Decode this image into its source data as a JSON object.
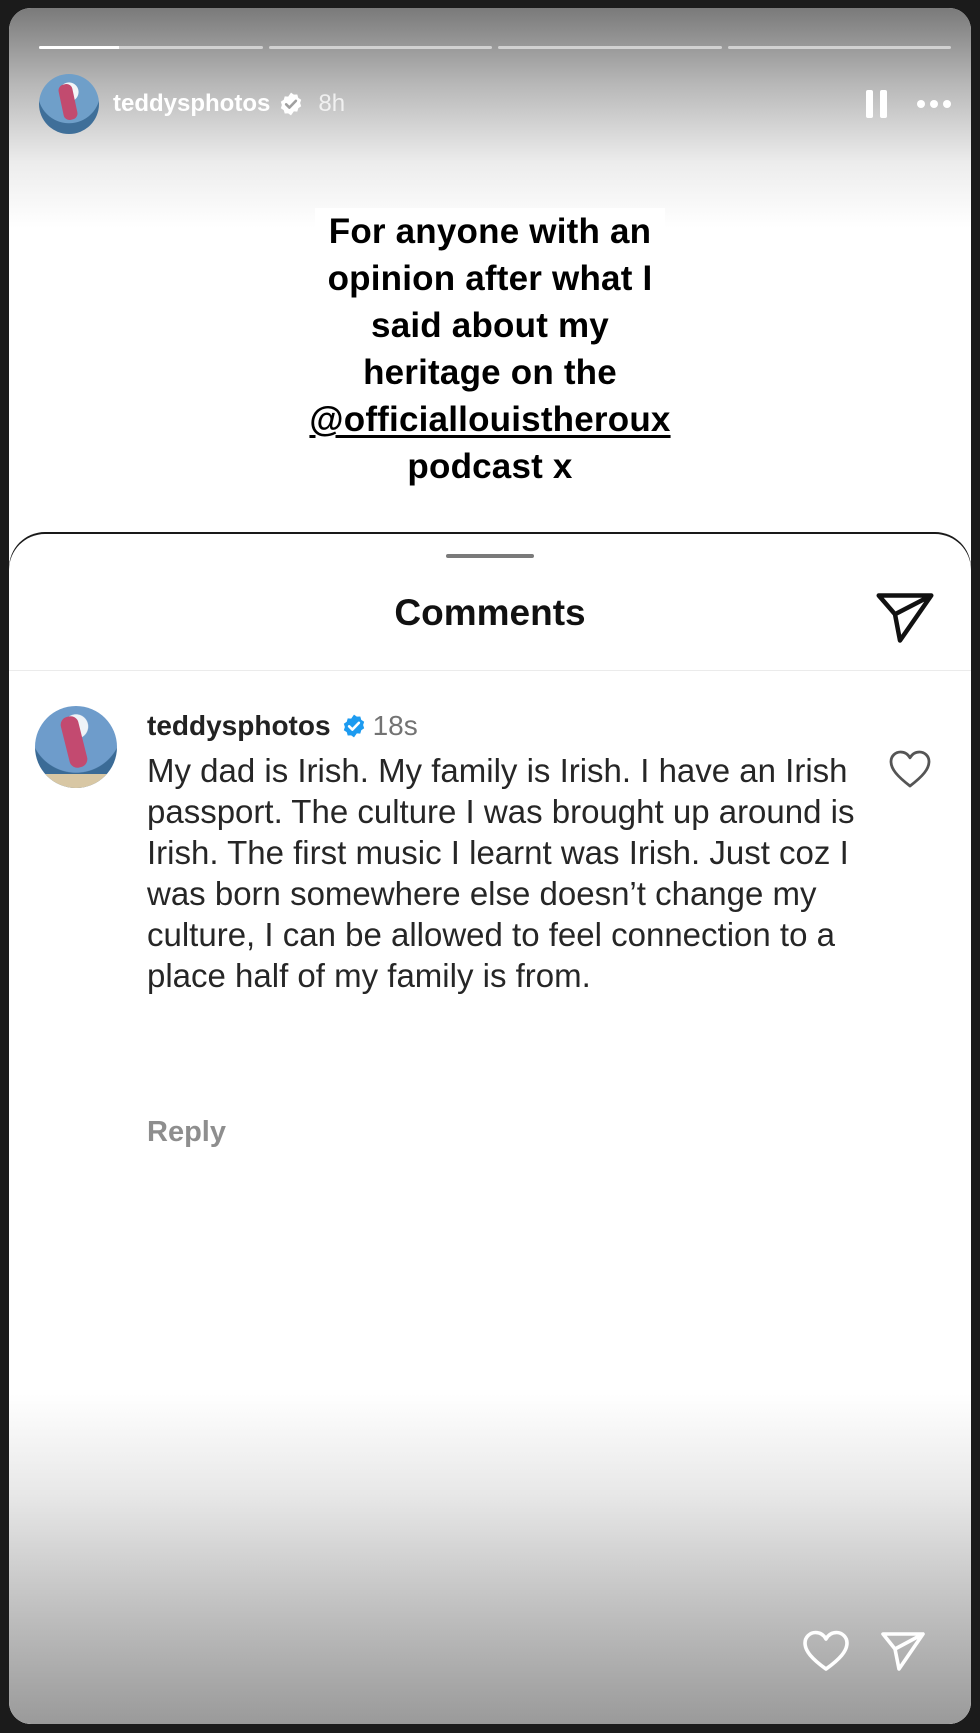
{
  "story": {
    "progress": [
      0.36,
      0,
      0,
      0
    ],
    "username": "teddysphotos",
    "time": "8h",
    "caption_lines": [
      "For anyone with an",
      "opinion after what I",
      "said about my",
      "heritage on the",
      "@officiallouistheroux",
      "podcast x"
    ]
  },
  "comments_sheet": {
    "title": "Comments",
    "comment": {
      "username": "teddysphotos",
      "time": "18s",
      "text": "My dad is Irish. My family is Irish. I have an Irish passport. The culture I was brought up around is Irish. The first music I learnt was Irish. Just coz I was born somewhere else doesn’t change my culture, I can be allowed to feel connection to a place half of my family is from.",
      "reply_label": "Reply"
    }
  },
  "colors": {
    "verified_blue": "#1d9bf0",
    "secondary_text": "#737373"
  },
  "icons": {
    "pause": "pause-icon",
    "more": "more-icon",
    "share": "send-icon",
    "like": "heart-icon",
    "verified": "verified-badge-icon"
  }
}
